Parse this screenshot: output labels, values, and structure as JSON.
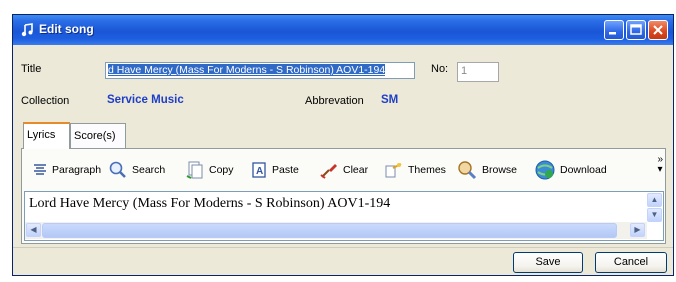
{
  "window": {
    "title": "Edit song"
  },
  "form": {
    "title_label": "Title",
    "title_value": "d Have Mercy (Mass For Moderns - S Robinson) AOV1-194",
    "no_label": "No:",
    "no_value": "1",
    "collection_label": "Collection",
    "collection_value": "Service Music",
    "abbreviation_label": "Abbrevation",
    "abbreviation_value": "SM"
  },
  "tabs": [
    {
      "label": "Lyrics"
    },
    {
      "label": "Score(s)"
    }
  ],
  "toolbar": {
    "items": [
      {
        "label": "Paragraph",
        "icon": "paragraph-icon"
      },
      {
        "label": "Search",
        "icon": "search-icon"
      },
      {
        "label": "Copy",
        "icon": "copy-icon"
      },
      {
        "label": "Paste",
        "icon": "paste-icon"
      },
      {
        "label": "Clear",
        "icon": "clear-icon"
      },
      {
        "label": "Themes",
        "icon": "themes-icon"
      },
      {
        "label": "Browse",
        "icon": "browse-icon"
      },
      {
        "label": "Download",
        "icon": "download-icon"
      }
    ],
    "more_label": "»"
  },
  "editor": {
    "text": "Lord Have Mercy (Mass For Moderns - S Robinson) AOV1-194"
  },
  "buttons": {
    "save": "Save",
    "cancel": "Cancel"
  },
  "colors": {
    "titlebar": "#1d5fe0",
    "field_value": "#1f3ec7",
    "selection": "#316ac5",
    "window_bg": "#ece9d8"
  }
}
